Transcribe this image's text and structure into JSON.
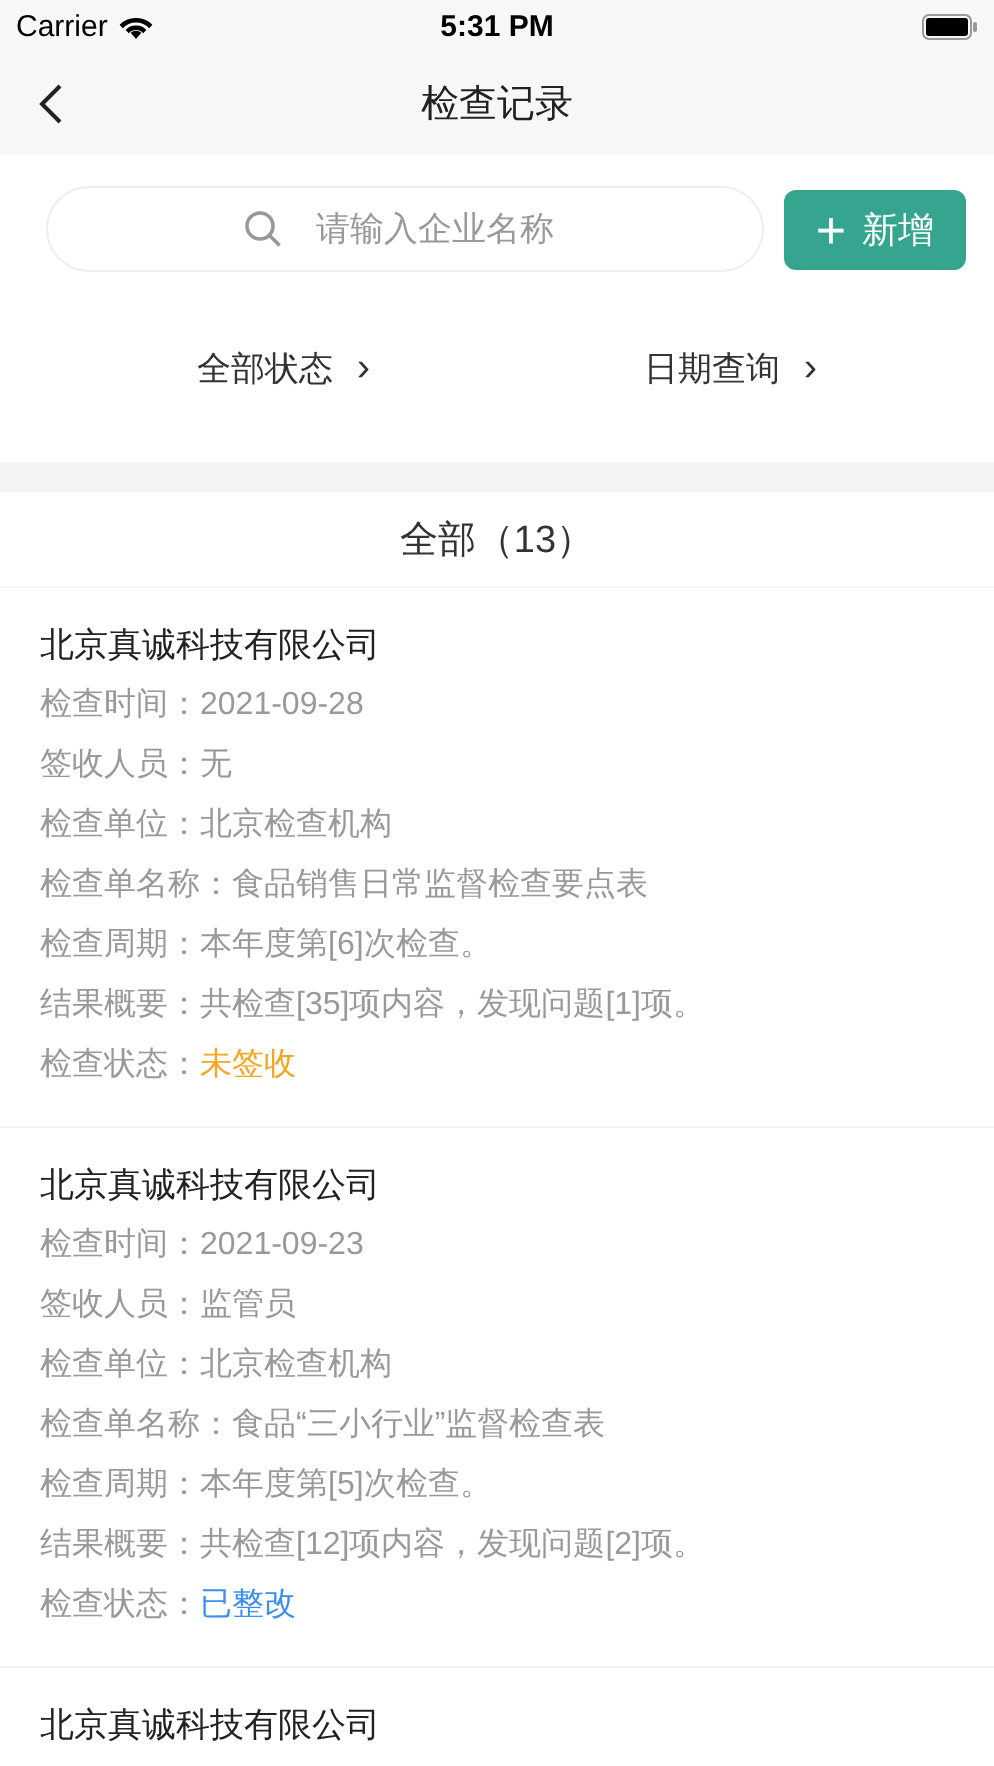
{
  "status_bar": {
    "carrier": "Carrier",
    "time": "5:31 PM"
  },
  "nav_bar": {
    "title": "检查记录"
  },
  "search": {
    "placeholder": "请输入企业名称"
  },
  "add_button": {
    "icon": "+",
    "label": "新增"
  },
  "filters": [
    {
      "label": "全部状态",
      "icon": "›"
    },
    {
      "label": "日期查询",
      "icon": "›"
    }
  ],
  "list_header": "全部（13）",
  "records": [
    {
      "company": "北京真诚科技有限公司",
      "fields": [
        {
          "label": "检查时间：",
          "value": "2021-09-28"
        },
        {
          "label": "签收人员：",
          "value": "无"
        },
        {
          "label": "检查单位：",
          "value": "北京检查机构"
        },
        {
          "label": "检查单名称：",
          "value": "食品销售日常监督检查要点表"
        },
        {
          "label": "检查周期：",
          "value": "本年度第[6]次检查。"
        },
        {
          "label": "结果概要：",
          "value": "共检查[35]项内容，发现问题[1]项。"
        },
        {
          "label": "检查状态：",
          "value": "未签收",
          "color": "#f5a623"
        }
      ]
    },
    {
      "company": "北京真诚科技有限公司",
      "fields": [
        {
          "label": "检查时间：",
          "value": "2021-09-23"
        },
        {
          "label": "签收人员：",
          "value": "监管员"
        },
        {
          "label": "检查单位：",
          "value": "北京检查机构"
        },
        {
          "label": "检查单名称：",
          "value": "食品“三小行业”监督检查表"
        },
        {
          "label": "检查周期：",
          "value": "本年度第[5]次检查。"
        },
        {
          "label": "结果概要：",
          "value": "共检查[12]项内容，发现问题[2]项。"
        },
        {
          "label": "检查状态：",
          "value": "已整改",
          "color": "#3b8ff0"
        }
      ]
    },
    {
      "company": "北京真诚科技有限公司"
    }
  ]
}
